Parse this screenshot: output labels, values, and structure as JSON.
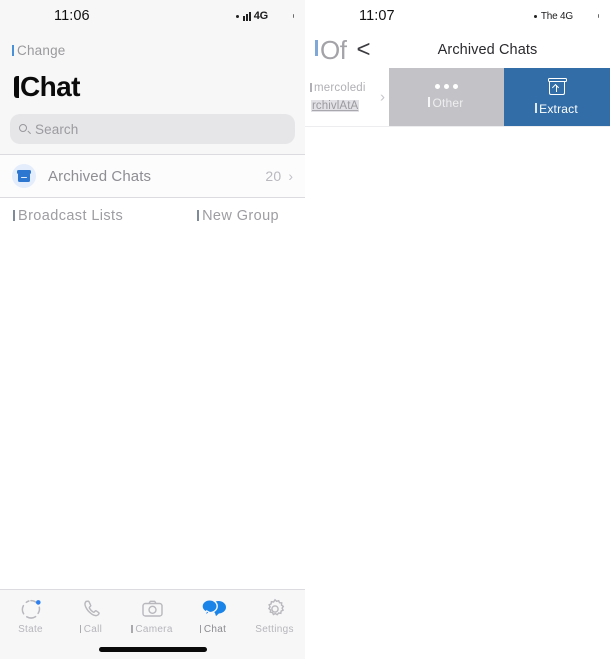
{
  "left": {
    "status": {
      "clock": "11:06",
      "network": "4G",
      "signal_icon": "signal-bars-icon",
      "battery_icon": "battery-icon"
    },
    "nav": {
      "change_label": "Change"
    },
    "title": "Chat",
    "search": {
      "placeholder": "Search",
      "icon": "search-icon"
    },
    "archived_row": {
      "icon": "archive-box-icon",
      "label": "Archived Chats",
      "count": "20",
      "chevron": "›"
    },
    "broadcast_row": {
      "broadcast_label": "Broadcast Lists",
      "new_group_label": "New Group"
    },
    "tabs": [
      {
        "label": "State",
        "icon": "state-ring-icon",
        "active": false
      },
      {
        "label": "Call",
        "icon": "phone-icon",
        "active": false
      },
      {
        "label": "Camera",
        "icon": "camera-icon",
        "active": false
      },
      {
        "label": "Chat",
        "icon": "chat-bubbles-icon",
        "active": true
      },
      {
        "label": "Settings",
        "icon": "gear-icon",
        "active": false
      }
    ]
  },
  "right": {
    "status": {
      "clock": "11:07",
      "network": "The 4G",
      "signal_icon": "signal-dot-icon",
      "battery_icon": "battery-icon"
    },
    "nav": {
      "of_label": "Of",
      "back_chevron": "‹",
      "title": "Archived Chats"
    },
    "swiped_row": {
      "date": "mercoledi",
      "snippet": "rchivlAtA",
      "chevron": "›",
      "actions": [
        {
          "label": "Other",
          "icon": "ellipsis-icon",
          "color": "#c3c3c7"
        },
        {
          "label": "Extract",
          "icon": "unarchive-icon",
          "color": "#326da8"
        }
      ]
    }
  },
  "colors": {
    "accent_blue": "#2e77d0",
    "extract_blue": "#326da8",
    "other_gray": "#c3c3c7",
    "panel_bg": "#f7f7f7",
    "tabbar_bg": "#f7f7f8",
    "search_bg": "#e6e6e8"
  }
}
